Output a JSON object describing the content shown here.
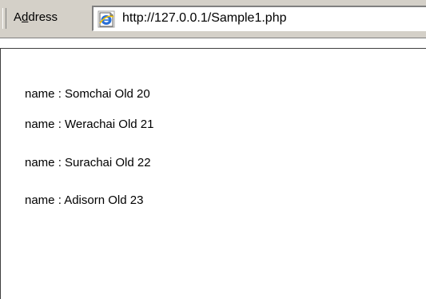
{
  "toolbar": {
    "address_label_access_key": "d",
    "address_label_prefix": "A",
    "address_label_suffix": "dress",
    "address_url": "http://127.0.0.1/Sample1.php",
    "icon": "ie-page-icon"
  },
  "page": {
    "lines": [
      "name : Somchai Old 20",
      "name : Werachai Old 21",
      "name : Surachai Old 22",
      "name : Adisorn Old 23"
    ]
  }
}
